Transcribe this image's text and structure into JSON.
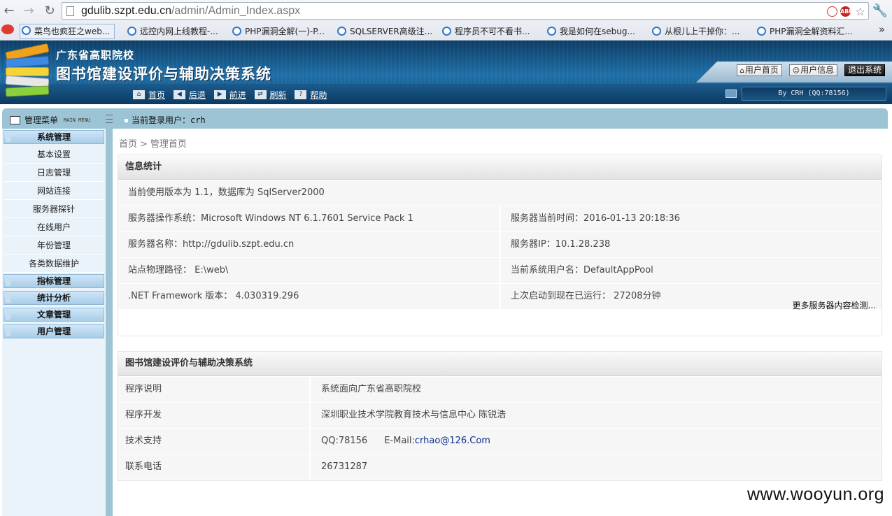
{
  "browser": {
    "url_host": "gdulib.szpt.edu.cn",
    "url_path": "/admin/Admin_Index.aspx",
    "bookmarks": [
      "菜鸟也疯狂之web...",
      "远控内网上线教程-...",
      "PHP漏洞全解(一)-P...",
      "SQLSERVER高级注...",
      "程序员不可不看书...",
      "我是如何在sebug...",
      "从根儿上干掉你：...",
      "PHP漏洞全解资料汇..."
    ],
    "more": "»",
    "abp_label": "ABP"
  },
  "header": {
    "org": "广东省高职院校",
    "system": "图书馆建设评价与辅助决策系统",
    "top_links": {
      "home": "用户首页",
      "info": "用户信息",
      "logout": "退出系统"
    },
    "nav": {
      "home": "首页",
      "back": "后退",
      "forward": "前进",
      "refresh": "刷新",
      "help": "帮助"
    },
    "credit": "By CRH (QQ:78156)"
  },
  "sidebar": {
    "title": "管理菜单",
    "subtitle": "MAIN MENU",
    "categories": {
      "system": "系统管理",
      "index": "指标管理",
      "stats": "统计分析",
      "article": "文章管理",
      "user": "用户管理"
    },
    "items": [
      "基本设置",
      "日志管理",
      "网站连接",
      "服务器探针",
      "在线用户",
      "年份管理",
      "各类数据维护"
    ]
  },
  "userbar": {
    "label": "当前登录用户：",
    "username": "crh"
  },
  "breadcrumb": {
    "home": "首页",
    "sep": ">",
    "current": "管理首页"
  },
  "info_panel": {
    "title": "信息统计",
    "version_line": "当前使用版本为 1.1，数据库为 SqlServer2000",
    "os": "服务器操作系统：Microsoft Windows NT 6.1.7601 Service Pack 1",
    "time": "服务器当前时间：2016-01-13 20:18:36",
    "name": "服务器名称：http://gdulib.szpt.edu.cn",
    "ip": "服务器IP：10.1.28.238",
    "path": "站点物理路径： E:\\web\\",
    "sysuser": "当前系统用户名：DefaultAppPool",
    "dotnet": ".NET Framework 版本： 4.030319.296",
    "uptime": "上次启动到现在已运行： 27208分钟",
    "more": "更多服务器内容检测..."
  },
  "about_panel": {
    "title": "图书馆建设评价与辅助决策系统",
    "rows": {
      "desc_label": "程序说明",
      "desc_value": "系统面向广东省高职院校",
      "dev_label": "程序开发",
      "dev_value": "深圳职业技术学院教育技术与信息中心 陈锐浩",
      "support_label": "技术支持",
      "support_qq": "QQ:78156",
      "support_email_label": "E-Mail:",
      "support_email": "crhao@126.Com",
      "phone_label": "联系电话",
      "phone_value": "26731287"
    }
  },
  "watermark": "www.wooyun.org",
  "colors": {
    "header_blue": "#1f6fa8",
    "frame_teal": "#9dc4d4",
    "menu_cat": "#a8cde8"
  }
}
